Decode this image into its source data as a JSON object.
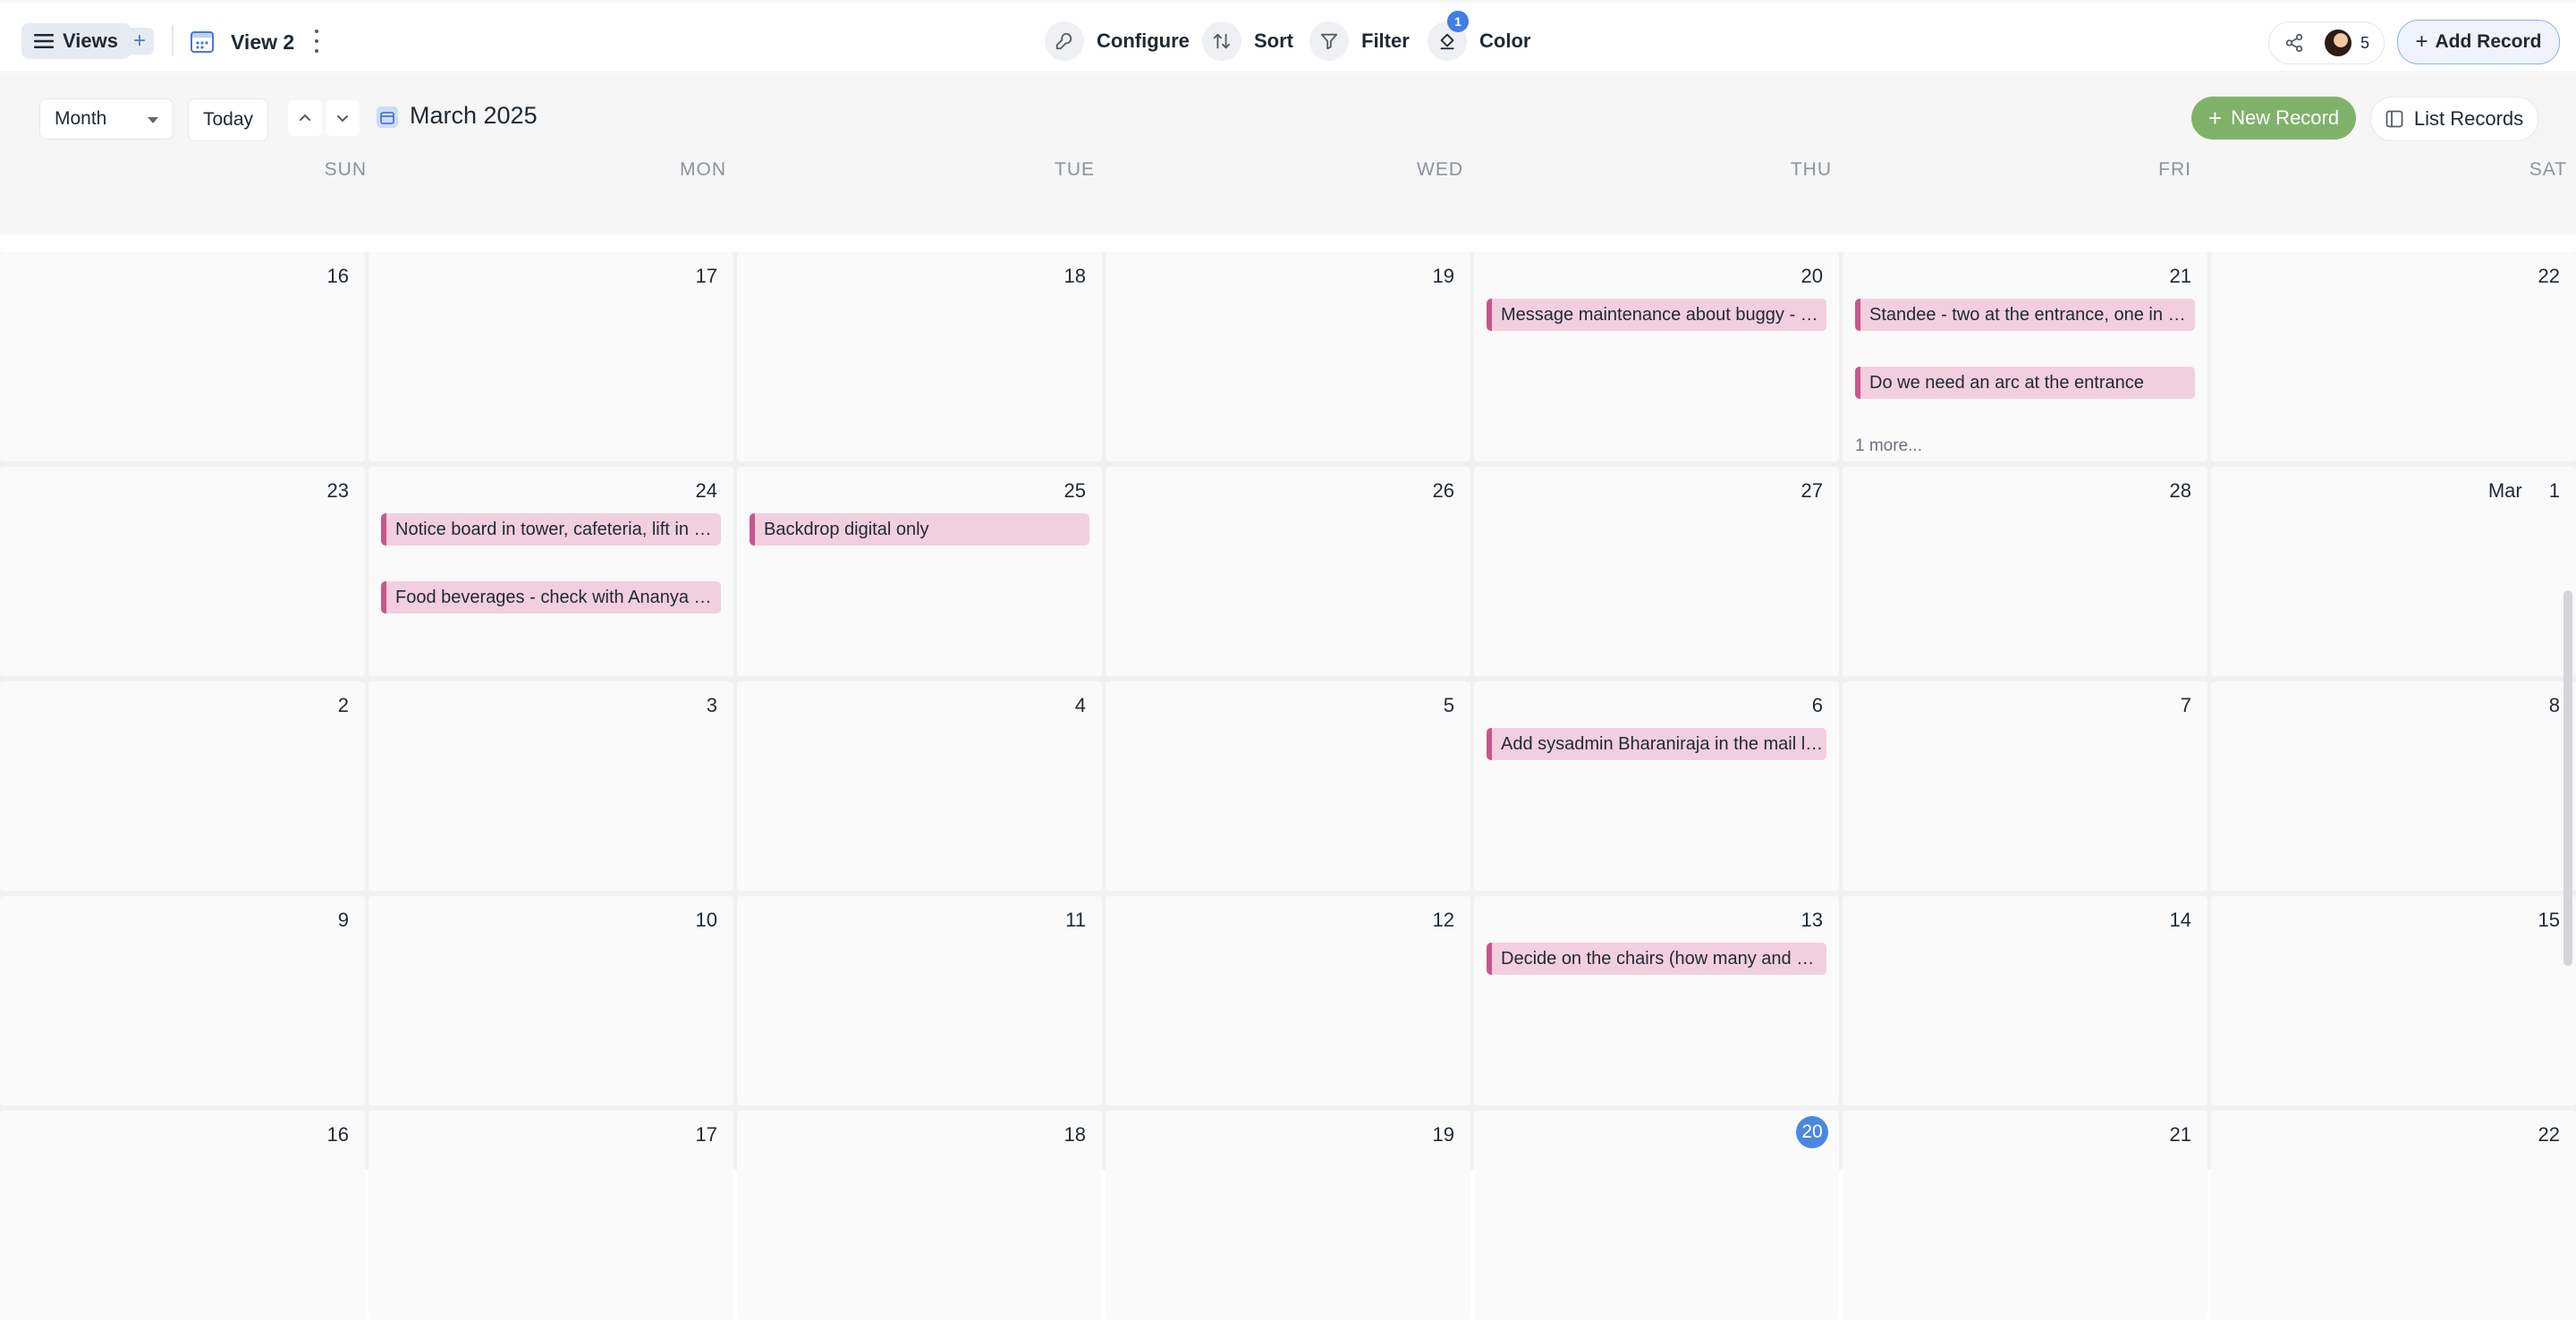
{
  "toolbar": {
    "views_label": "Views",
    "view_name": "View 2",
    "configure_label": "Configure",
    "sort_label": "Sort",
    "filter_label": "Filter",
    "color_label": "Color",
    "color_badge": "1",
    "collaborators_count": "5",
    "add_record_label": "Add Record"
  },
  "calendar_toolbar": {
    "mode": "Month",
    "today_label": "Today",
    "month_title": "March 2025",
    "new_record_label": "New Record",
    "list_records_label": "List Records"
  },
  "weekdays": [
    "SUN",
    "MON",
    "TUE",
    "WED",
    "THU",
    "FRI",
    "SAT"
  ],
  "weeks": [
    {
      "days": [
        {
          "num": "16",
          "events": []
        },
        {
          "num": "17",
          "events": []
        },
        {
          "num": "18",
          "events": []
        },
        {
          "num": "19",
          "events": []
        },
        {
          "num": "20",
          "events": [
            "Message maintenance about buggy - how and when to pick up guests"
          ]
        },
        {
          "num": "21",
          "events": [
            "Standee - two at the entrance, one in building lobby",
            "Do we need an arc at the entrance"
          ],
          "more": "1 more..."
        },
        {
          "num": "22",
          "events": []
        }
      ]
    },
    {
      "days": [
        {
          "num": "23",
          "events": []
        },
        {
          "num": "24",
          "events": [
            "Notice board in tower, cafeteria, lift in Main building",
            "Food beverages - check with Ananya on menu"
          ]
        },
        {
          "num": "25",
          "events": [
            "Backdrop digital only"
          ]
        },
        {
          "num": "26",
          "events": []
        },
        {
          "num": "27",
          "events": []
        },
        {
          "num": "28",
          "events": []
        },
        {
          "num": "1",
          "month_prefix": "Mar",
          "events": []
        }
      ]
    },
    {
      "days": [
        {
          "num": "2",
          "events": []
        },
        {
          "num": "3",
          "events": []
        },
        {
          "num": "4",
          "events": []
        },
        {
          "num": "5",
          "events": []
        },
        {
          "num": "6",
          "events": [
            "Add sysadmin Bharaniraja in the mail loop"
          ]
        },
        {
          "num": "7",
          "events": []
        },
        {
          "num": "8",
          "events": []
        }
      ]
    },
    {
      "days": [
        {
          "num": "9",
          "events": []
        },
        {
          "num": "10",
          "events": []
        },
        {
          "num": "11",
          "events": []
        },
        {
          "num": "12",
          "events": []
        },
        {
          "num": "13",
          "events": [
            "Decide on the chairs (how many and where to place them)"
          ]
        },
        {
          "num": "14",
          "events": []
        },
        {
          "num": "15",
          "events": []
        }
      ]
    },
    {
      "days": [
        {
          "num": "16",
          "events": []
        },
        {
          "num": "17",
          "events": []
        },
        {
          "num": "18",
          "events": []
        },
        {
          "num": "19",
          "events": []
        },
        {
          "num": "20",
          "events": [],
          "today": true
        },
        {
          "num": "21",
          "events": []
        },
        {
          "num": "22",
          "events": []
        }
      ]
    }
  ],
  "colors": {
    "event_bg": "#f2cfde",
    "event_accent": "#c9568a",
    "new_record_bg": "#81b26a",
    "today_bg": "#4a87e0",
    "badge_bg": "#3d7ee8"
  }
}
